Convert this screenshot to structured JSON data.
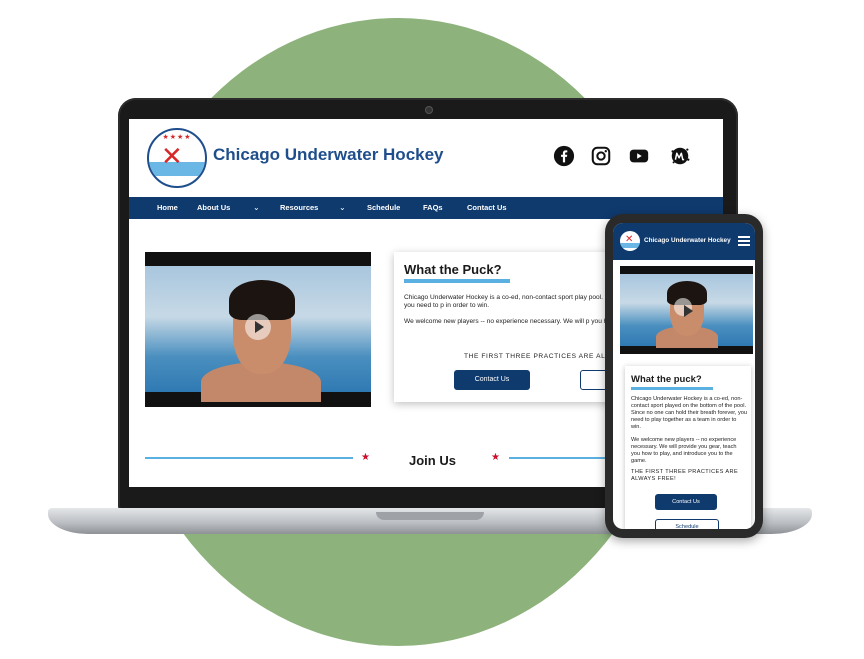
{
  "site": {
    "title": "Chicago Underwater Hockey",
    "logo_stars": "★★★★"
  },
  "social": [
    "facebook-icon",
    "instagram-icon",
    "youtube-icon",
    "meetup-icon"
  ],
  "nav": {
    "items": [
      {
        "label": "Home"
      },
      {
        "label": "About Us"
      },
      {
        "label": "Resources"
      },
      {
        "label": "Schedule"
      },
      {
        "label": "FAQs"
      },
      {
        "label": "Contact Us"
      }
    ]
  },
  "intro": {
    "title": "What the Puck?",
    "paragraph1": "Chicago Underwater Hockey is a co-ed, non-contact sport play pool. Since no one can hold their breath forever, you need to p in order to win.",
    "paragraph2": "We welcome new players -- no experience necessary. We will p you how to play, and introduce you to the game.",
    "caps": "THE FIRST THREE PRACTICES ARE ALW",
    "contact_button": "Contact Us"
  },
  "join": {
    "title": "Join Us",
    "star": "★"
  },
  "mobile": {
    "header_title": "Chicago Underwater Hockey",
    "card_title": "What the puck?",
    "paragraph1": "Chicago Underwater Hockey is a co-ed, non-contact sport played on the bottom of the pool. Since no one can hold their breath forever, you need to play together as a team in order to win.",
    "paragraph2": "We welcome new players -- no experience necessary. We will provide you gear, teach you how to play, and introduce you to the game.",
    "caps": "THE FIRST THREE PRACTICES ARE ALWAYS FREE!",
    "contact_button": "Contact Us",
    "schedule_button": "Schedule"
  },
  "colors": {
    "navy": "#0f3a6e",
    "accent_blue": "#5ab0e0",
    "star_red": "#c8102e",
    "background_blob": "#8db27c"
  }
}
